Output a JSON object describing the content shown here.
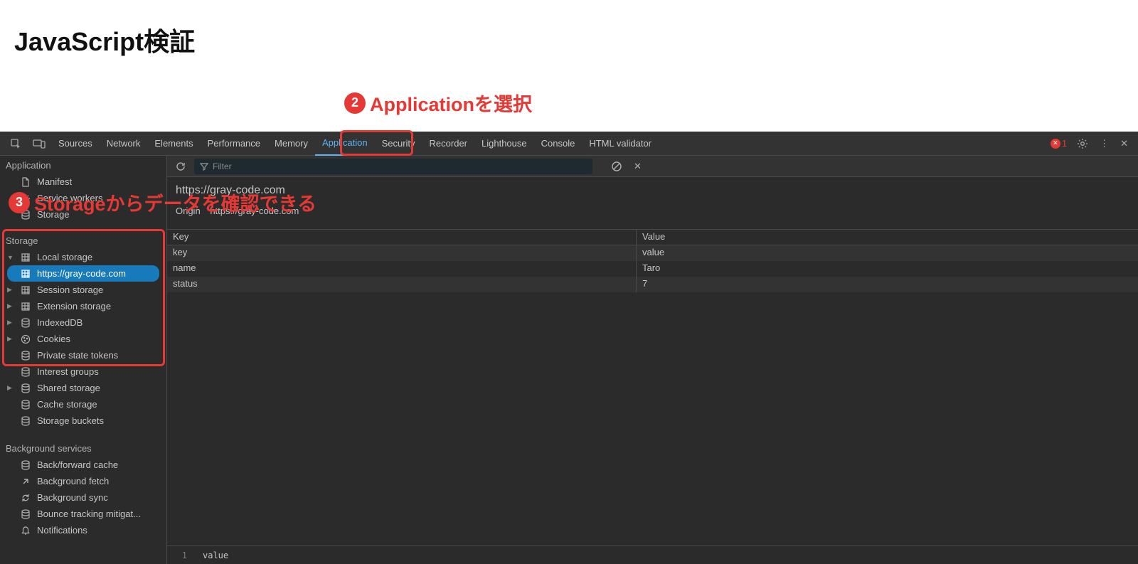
{
  "page": {
    "title": "JavaScript検証"
  },
  "annotations": {
    "a2": {
      "num": "2",
      "text": "Applicationを選択"
    },
    "a3": {
      "num": "3",
      "text": "Storageからデータを確認できる"
    }
  },
  "tabs": [
    "Sources",
    "Network",
    "Elements",
    "Performance",
    "Memory",
    "Application",
    "Security",
    "Recorder",
    "Lighthouse",
    "Console",
    "HTML validator"
  ],
  "activeTab": "Application",
  "errorCount": "1",
  "sidebar": {
    "application": {
      "title": "Application",
      "items": [
        {
          "label": "Manifest",
          "icon": "file"
        },
        {
          "label": "Service workers",
          "icon": "gear"
        },
        {
          "label": "Storage",
          "icon": "db"
        }
      ]
    },
    "storage": {
      "title": "Storage",
      "items": [
        {
          "label": "Local storage",
          "icon": "grid",
          "arrow": "down",
          "children": [
            {
              "label": "https://gray-code.com",
              "icon": "grid",
              "selected": true
            }
          ]
        },
        {
          "label": "Session storage",
          "icon": "grid",
          "arrow": "right"
        },
        {
          "label": "Extension storage",
          "icon": "grid",
          "arrow": "right"
        },
        {
          "label": "IndexedDB",
          "icon": "db",
          "arrow": "right"
        },
        {
          "label": "Cookies",
          "icon": "cookie",
          "arrow": "right"
        },
        {
          "label": "Private state tokens",
          "icon": "db",
          "arrow": "none"
        },
        {
          "label": "Interest groups",
          "icon": "db",
          "arrow": "none"
        },
        {
          "label": "Shared storage",
          "icon": "db",
          "arrow": "right"
        },
        {
          "label": "Cache storage",
          "icon": "db",
          "arrow": "none"
        },
        {
          "label": "Storage buckets",
          "icon": "db",
          "arrow": "none"
        }
      ]
    },
    "background": {
      "title": "Background services",
      "items": [
        {
          "label": "Back/forward cache",
          "icon": "db"
        },
        {
          "label": "Background fetch",
          "icon": "upright"
        },
        {
          "label": "Background sync",
          "icon": "sync"
        },
        {
          "label": "Bounce tracking mitigat...",
          "icon": "db"
        },
        {
          "label": "Notifications",
          "icon": "bell"
        }
      ]
    }
  },
  "toolbar": {
    "filterPlaceholder": "Filter"
  },
  "origin": {
    "heading": "https://gray-code.com",
    "label": "Origin",
    "url": "https://gray-code.com"
  },
  "table": {
    "headers": {
      "key": "Key",
      "value": "Value"
    },
    "rows": [
      {
        "key": "key",
        "value": "value"
      },
      {
        "key": "name",
        "value": "Taro"
      },
      {
        "key": "status",
        "value": "7"
      }
    ]
  },
  "editor": {
    "line": "1",
    "value": "value"
  }
}
